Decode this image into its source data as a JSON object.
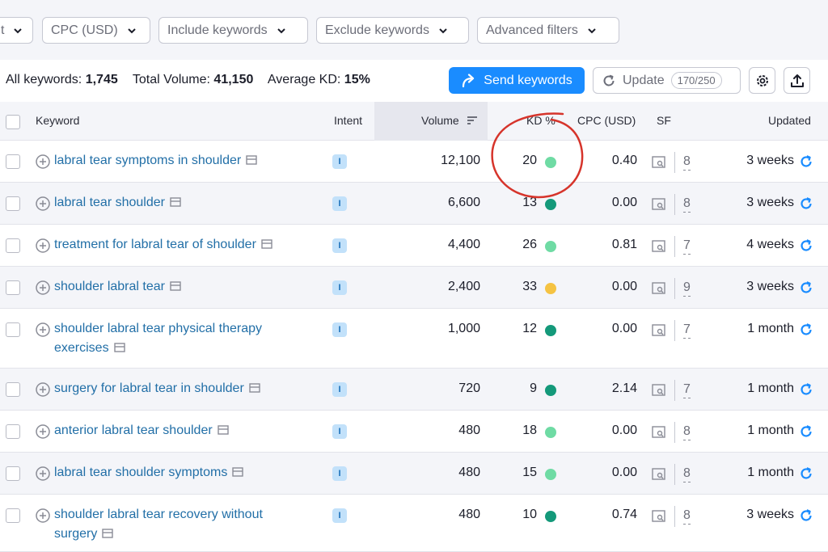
{
  "filters": {
    "partial_label": "t",
    "cpc_label": "CPC (USD)",
    "include_label": "Include keywords",
    "exclude_label": "Exclude keywords",
    "advanced_label": "Advanced filters"
  },
  "summary": {
    "all_keywords_label": "All keywords:",
    "all_keywords_value": "1,745",
    "total_volume_label": "Total Volume:",
    "total_volume_value": "41,150",
    "avg_kd_label": "Average KD:",
    "avg_kd_value": "15%"
  },
  "toolbar": {
    "send_label": "Send keywords",
    "update_label": "Update",
    "quota": "170/250",
    "icons": [
      "settings-gear-icon",
      "export-icon"
    ]
  },
  "table": {
    "headers": {
      "keyword": "Keyword",
      "intent": "Intent",
      "volume": "Volume",
      "kd": "KD %",
      "cpc": "CPC (USD)",
      "sf": "SF",
      "updated": "Updated"
    },
    "rows": [
      {
        "keyword": "labral tear symptoms in shoulder",
        "intent": "I",
        "volume": "12,100",
        "kd": "20",
        "kd_color": "#6fdba4",
        "cpc": "0.40",
        "sf": "8",
        "updated": "3 weeks"
      },
      {
        "keyword": "labral tear shoulder",
        "intent": "I",
        "volume": "6,600",
        "kd": "13",
        "kd_color": "#14997a",
        "cpc": "0.00",
        "sf": "8",
        "updated": "3 weeks"
      },
      {
        "keyword": "treatment for labral tear of shoulder",
        "intent": "I",
        "volume": "4,400",
        "kd": "26",
        "kd_color": "#6fdba4",
        "cpc": "0.81",
        "sf": "7",
        "updated": "4 weeks"
      },
      {
        "keyword": "shoulder labral tear",
        "intent": "I",
        "volume": "2,400",
        "kd": "33",
        "kd_color": "#f5c343",
        "cpc": "0.00",
        "sf": "9",
        "updated": "3 weeks"
      },
      {
        "keyword": "shoulder labral tear physical therapy exercises",
        "intent": "I",
        "volume": "1,000",
        "kd": "12",
        "kd_color": "#14997a",
        "cpc": "0.00",
        "sf": "7",
        "updated": "1 month"
      },
      {
        "keyword": "surgery for labral tear in shoulder",
        "intent": "I",
        "volume": "720",
        "kd": "9",
        "kd_color": "#14997a",
        "cpc": "2.14",
        "sf": "7",
        "updated": "1 month"
      },
      {
        "keyword": "anterior labral tear shoulder",
        "intent": "I",
        "volume": "480",
        "kd": "18",
        "kd_color": "#6fdba4",
        "cpc": "0.00",
        "sf": "8",
        "updated": "1 month"
      },
      {
        "keyword": "labral tear shoulder symptoms",
        "intent": "I",
        "volume": "480",
        "kd": "15",
        "kd_color": "#6fdba4",
        "cpc": "0.00",
        "sf": "8",
        "updated": "1 month"
      },
      {
        "keyword": "shoulder labral tear recovery without surgery",
        "intent": "I",
        "volume": "480",
        "kd": "10",
        "kd_color": "#14997a",
        "cpc": "0.74",
        "sf": "8",
        "updated": "3 weeks"
      }
    ]
  },
  "colors": {
    "accent": "#1a8cff",
    "link": "#226fa7",
    "annotation": "#d6342b"
  }
}
